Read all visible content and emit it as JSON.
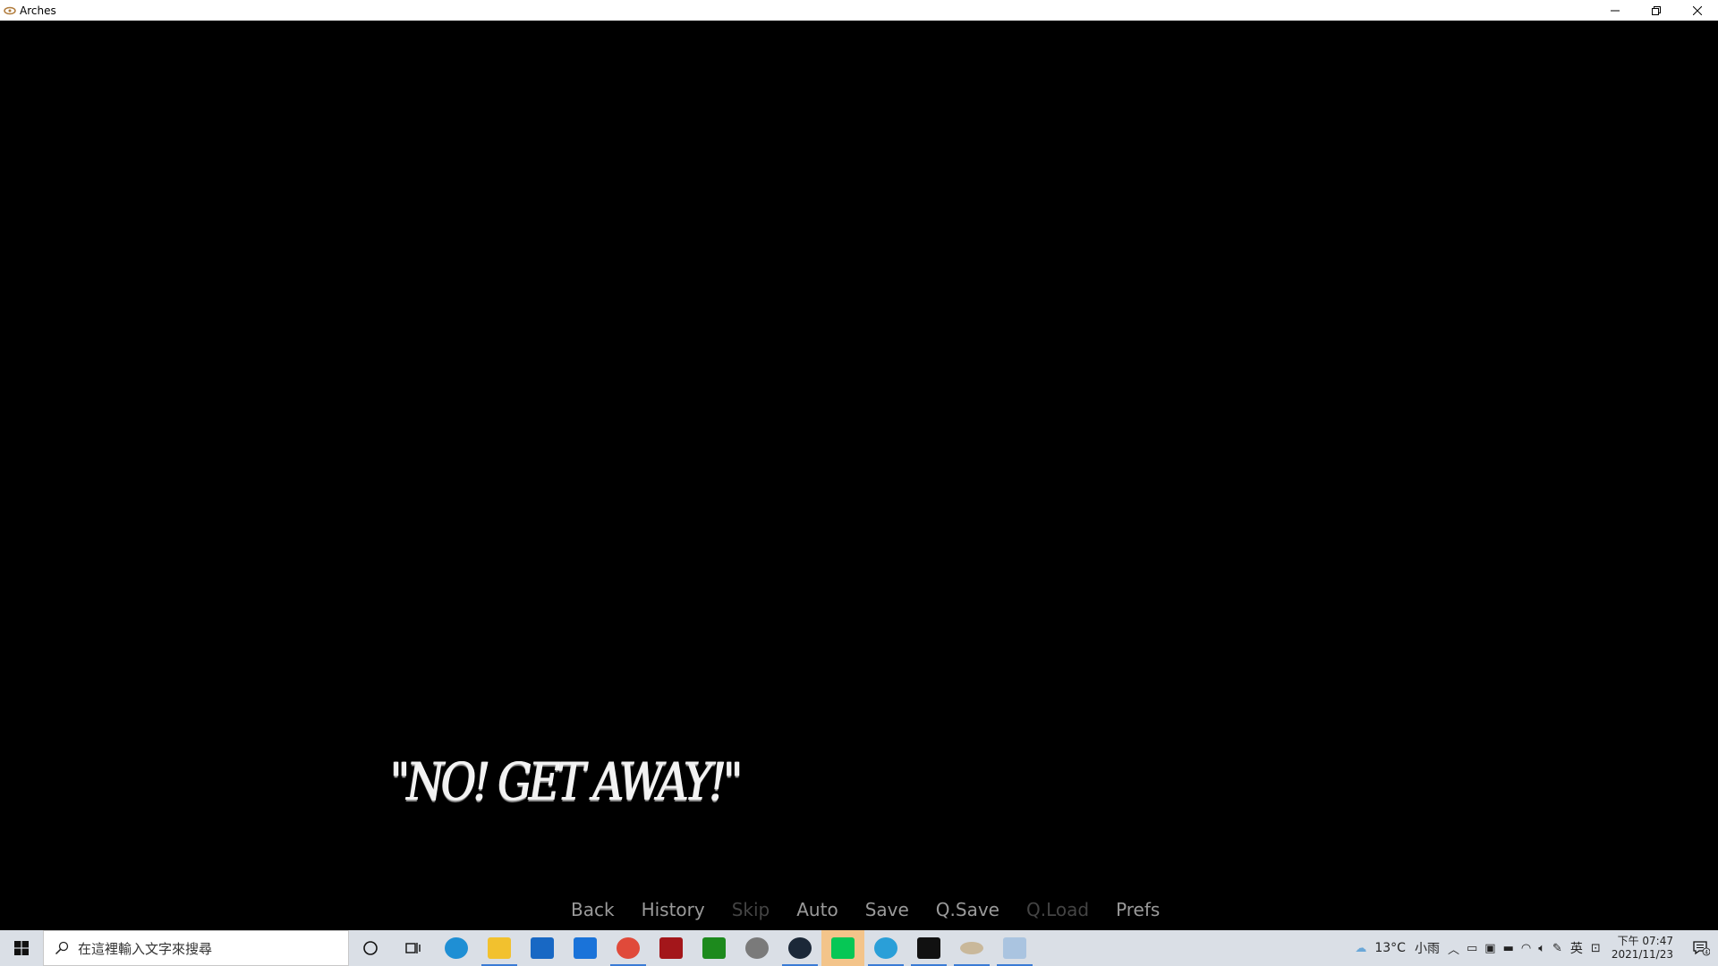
{
  "window": {
    "title": "Arches",
    "controls": {
      "minimize": "─",
      "restore": "❐",
      "close": "✕"
    }
  },
  "game": {
    "dialogue": "\"NO! GET AWAY!\"",
    "quick_menu": [
      {
        "label": "Back",
        "enabled": true
      },
      {
        "label": "History",
        "enabled": true
      },
      {
        "label": "Skip",
        "enabled": false
      },
      {
        "label": "Auto",
        "enabled": true
      },
      {
        "label": "Save",
        "enabled": true
      },
      {
        "label": "Q.Save",
        "enabled": true
      },
      {
        "label": "Q.Load",
        "enabled": false
      },
      {
        "label": "Prefs",
        "enabled": true
      }
    ]
  },
  "taskbar": {
    "search_placeholder": "在這裡輸入文字來搜尋",
    "apps": [
      {
        "name": "cortana-icon"
      },
      {
        "name": "task-view-icon"
      },
      {
        "name": "edge-icon",
        "color": "#1f8fd4"
      },
      {
        "name": "file-explorer-icon",
        "color": "#f2c12e"
      },
      {
        "name": "store-icon",
        "color": "#1868c4"
      },
      {
        "name": "mail-icon",
        "color": "#1a73d9"
      },
      {
        "name": "chrome-icon",
        "color": "#e04a3a"
      },
      {
        "name": "red-app-icon",
        "color": "#a3161a"
      },
      {
        "name": "xbox-icon",
        "color": "#1d8a1d"
      },
      {
        "name": "link-app-icon",
        "color": "#7a7a7a"
      },
      {
        "name": "steam-icon",
        "color": "#1b2838"
      },
      {
        "name": "line-icon",
        "color": "#06c755"
      },
      {
        "name": "telegram-icon",
        "color": "#2a9fd8"
      },
      {
        "name": "7zip-icon",
        "color": "#111111"
      },
      {
        "name": "arches-icon",
        "color": "#c9b89a"
      },
      {
        "name": "paint-icon",
        "color": "#aac4e0"
      }
    ],
    "weather": {
      "temp": "13°C",
      "condition": "小雨"
    },
    "ime": "英",
    "clock": {
      "time": "下午 07:47",
      "date": "2021/11/23"
    },
    "notification_count": "4"
  }
}
